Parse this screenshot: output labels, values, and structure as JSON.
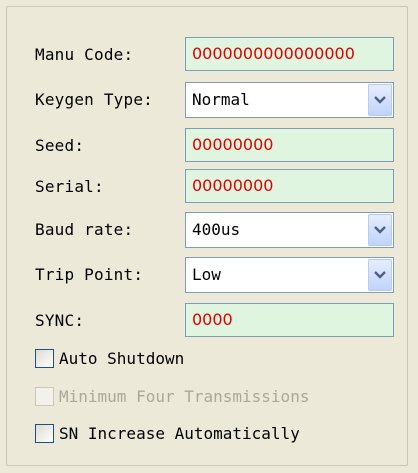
{
  "form": {
    "manu_code": {
      "label": "Manu Code:",
      "value": "0000000000000000"
    },
    "keygen_type": {
      "label": "Keygen Type:",
      "value": "Normal"
    },
    "seed": {
      "label": "Seed:",
      "value": "00000000"
    },
    "serial": {
      "label": "Serial:",
      "value": "00000000"
    },
    "baud_rate": {
      "label": "Baud rate:",
      "value": "400us"
    },
    "trip_point": {
      "label": "Trip Point:",
      "value": "Low"
    },
    "sync": {
      "label": "SYNC:",
      "value": "0000"
    }
  },
  "checkboxes": {
    "auto_shutdown": {
      "label": "Auto Shutdown",
      "checked": false,
      "enabled": true
    },
    "min_four_transmissions": {
      "label": "Minimum Four Transmissions",
      "checked": false,
      "enabled": false
    },
    "sn_increase": {
      "label": "SN Increase Automatically",
      "checked": false,
      "enabled": true
    }
  },
  "colors": {
    "background": "#ece9d8",
    "field_background": "#dff5df",
    "field_text": "#e00000",
    "disabled_text": "#aca899"
  },
  "icons": {
    "dropdown": "chevron-down-icon"
  }
}
